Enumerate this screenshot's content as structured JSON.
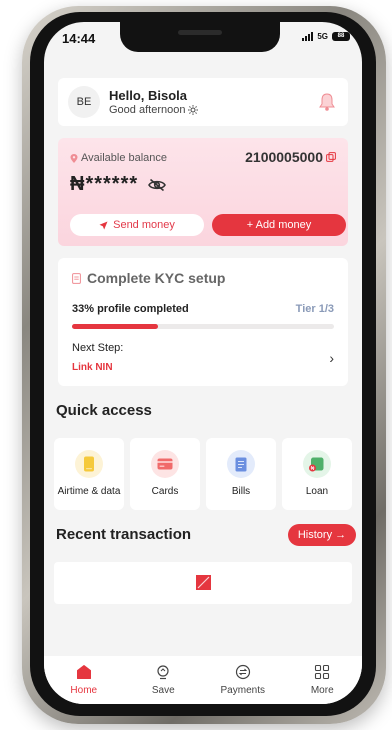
{
  "status_bar": {
    "time": "14:44",
    "network": "5G",
    "battery": "88"
  },
  "header": {
    "avatar_initials": "BE",
    "greeting": "Hello, Bisola",
    "subtitle": "Good afternoon",
    "subtitle_icon": "sun-icon",
    "notification_icon": "bell-icon"
  },
  "balance": {
    "label": "Available balance",
    "account_number": "2100005000",
    "masked_amount": "₦******",
    "send_label": "Send money",
    "add_label": "+  Add money",
    "colors": {
      "accent": "#e5363f",
      "card_bg": "#fde4ea"
    }
  },
  "kyc": {
    "title": "Complete KYC setup",
    "progress_text": "33% profile completed",
    "progress_percent": 33,
    "tier": "Tier 1/3",
    "next_label": "Next Step:",
    "next_value": "Link NIN"
  },
  "quick_access": {
    "title": "Quick access",
    "items": [
      {
        "label": "Airtime & data",
        "icon": "phone-icon",
        "color": "#f5c93b",
        "bg": "#fdf3d6"
      },
      {
        "label": "Cards",
        "icon": "card-icon",
        "color": "#f06a6a",
        "bg": "#fde4e4"
      },
      {
        "label": "Bills",
        "icon": "bill-icon",
        "color": "#6b8fe0",
        "bg": "#e3ebfb"
      },
      {
        "label": "Loan",
        "icon": "loan-wallet-icon",
        "color": "#4fb06a",
        "bg": "#e4f5e8"
      }
    ]
  },
  "recent": {
    "title": "Recent transaction",
    "history_label": "History →"
  },
  "nav": {
    "items": [
      {
        "label": "Home",
        "icon": "home-icon"
      },
      {
        "label": "Save",
        "icon": "save-icon"
      },
      {
        "label": "Payments",
        "icon": "payments-icon"
      },
      {
        "label": "More",
        "icon": "grid-icon"
      }
    ]
  }
}
